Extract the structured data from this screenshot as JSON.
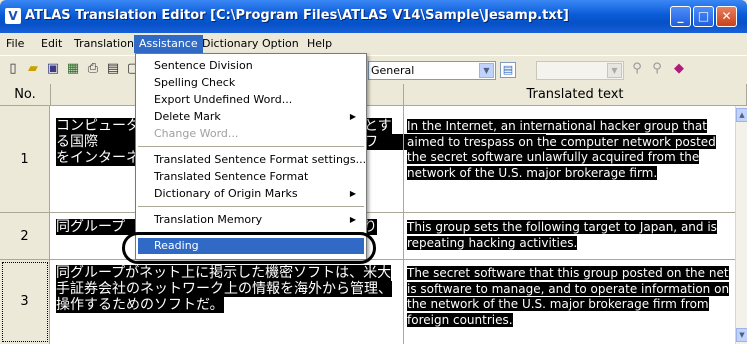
{
  "window": {
    "title": "ATLAS Translation Editor  [C:\\Program Files\\ATLAS V14\\Sample\\Jesamp.txt]",
    "minimize_glyph": "_",
    "maximize_glyph": "□",
    "close_glyph": "✕"
  },
  "menubar": {
    "items": [
      "File",
      "Edit",
      "Translation",
      "Assistance",
      "Dictionary",
      "Option",
      "Help"
    ]
  },
  "toolbar": {
    "field_combo_value": "General"
  },
  "assistance_menu": {
    "items": [
      {
        "label": "Sentence Division",
        "enabled": true,
        "submenu": false
      },
      {
        "label": "Spelling Check",
        "enabled": true,
        "submenu": false
      },
      {
        "label": "Export Undefined Word...",
        "enabled": true,
        "submenu": false
      },
      {
        "label": "Delete Mark",
        "enabled": true,
        "submenu": true
      },
      {
        "label": "Change Word...",
        "enabled": false,
        "submenu": false
      },
      {
        "label": "Translated Sentence Format settings...",
        "enabled": true,
        "submenu": false
      },
      {
        "label": "Translated Sentence Format",
        "enabled": true,
        "submenu": false
      },
      {
        "label": "Dictionary of Origin Marks",
        "enabled": true,
        "submenu": true
      },
      {
        "label": "Translation Memory",
        "enabled": true,
        "submenu": true
      },
      {
        "label": "Reading",
        "enabled": true,
        "submenu": false,
        "selected": true
      }
    ]
  },
  "table": {
    "headers": [
      "No.",
      "",
      "Translated text"
    ],
    "rows": [
      {
        "no": "1",
        "source": "コンピュータ　　　　　　　　　　　　　を目的とする国際　　　　　　　　　　　　券会社のネットワ　　　　　　　　　　　　をインターネット",
        "translated": "In the Internet, an international hacker group that aimed to trespass on the computer network posted the secret software unlawfully acquired from the network of the U.S. major brokerage firm."
      },
      {
        "no": "2",
        "source": "同グループ　　　　　　　　　　　　　行為を繰り",
        "translated": "This group sets the following target to Japan, and is repeating hacking activities."
      },
      {
        "no": "3",
        "source": "同グループがネット上に掲示した機密ソフトは、米大手証券会社のネットワーク上の情報を海外から管理、操作するためのソフトだ。",
        "translated": "The secret software that this group posted on the net is software to manage, and to operate information on the network of the U.S. major brokerage firm from foreign countries."
      }
    ]
  }
}
